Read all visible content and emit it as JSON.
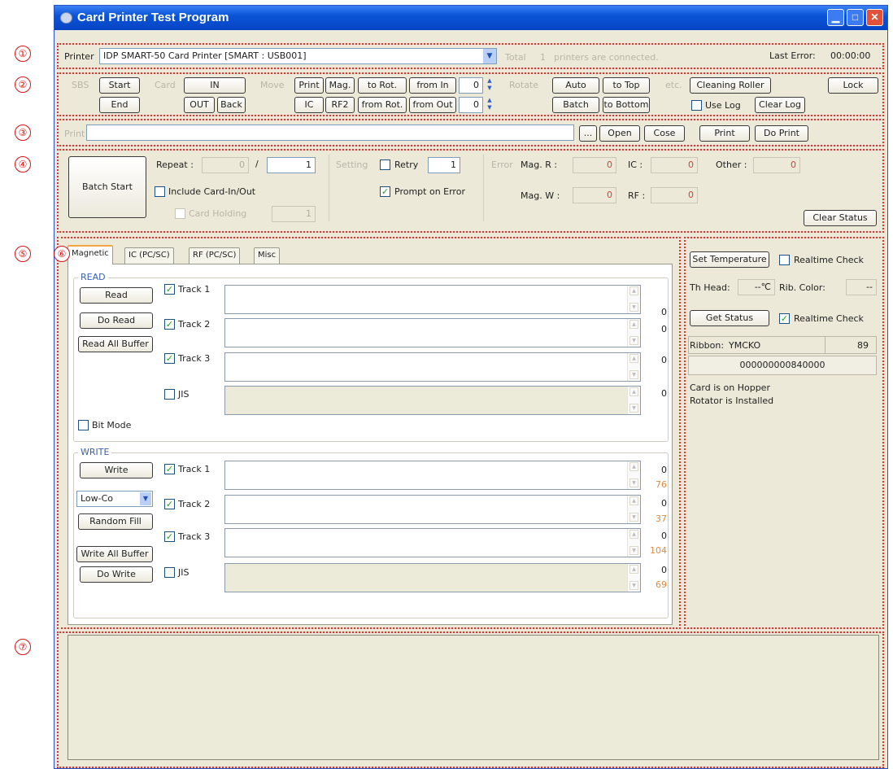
{
  "annotations": [
    "①",
    "②",
    "③",
    "④",
    "⑤",
    "⑥",
    "⑦"
  ],
  "window": {
    "title": "Card Printer Test Program"
  },
  "printer_row": {
    "label": "Printer",
    "selected": "IDP SMART-50 Card Printer  [SMART : USB001]",
    "total_label": "Total",
    "total_count": "1",
    "connected_text": "printers are connected.",
    "last_error_label": "Last Error:",
    "last_error_value": "00:00:00"
  },
  "toolbar": {
    "sbs": "SBS",
    "start": "Start",
    "end": "End",
    "card": "Card",
    "in": "IN",
    "out": "OUT",
    "back": "Back",
    "move": "Move",
    "print": "Print",
    "mag": "Mag.",
    "to_rot": "to Rot.",
    "from_in": "from In",
    "spin1": "0",
    "ic": "IC",
    "rf2": "RF2",
    "from_rot": "from Rot.",
    "from_out": "from Out",
    "spin2": "0",
    "rotate": "Rotate",
    "auto": "Auto",
    "to_top": "to Top",
    "batch": "Batch",
    "to_bottom": "to Bottom",
    "etc": "etc.",
    "cleaning_roller": "Cleaning Roller",
    "lock": "Lock",
    "use_log": "Use Log",
    "clear_log": "Clear Log"
  },
  "print_row": {
    "label": "Print",
    "value": "",
    "browse": "...",
    "open": "Open",
    "close": "Cose",
    "print": "Print",
    "do_print": "Do Print"
  },
  "batch": {
    "batch_start": "Batch Start",
    "repeat_label": "Repeat :",
    "repeat_done": "0",
    "slash": "/",
    "repeat_total": "1",
    "include_card": "Include Card-In/Out",
    "card_holding": "Card Holding",
    "card_holding_val": "1",
    "setting": "Setting",
    "retry": "Retry",
    "retry_val": "1",
    "prompt_on_error": "Prompt on Error",
    "error": "Error",
    "mag_r": "Mag. R :",
    "mag_r_val": "0",
    "ic": "IC :",
    "ic_val": "0",
    "other": "Other :",
    "other_val": "0",
    "mag_w": "Mag. W :",
    "mag_w_val": "0",
    "rf": "RF :",
    "rf_val": "0",
    "clear_status": "Clear Status"
  },
  "tabs": [
    "Magnetic",
    "IC (PC/SC)",
    "RF (PC/SC)",
    "Misc"
  ],
  "read": {
    "title": "READ",
    "read": "Read",
    "do_read": "Do Read",
    "read_all": "Read All Buffer",
    "bit_mode": "Bit Mode",
    "tracks": [
      {
        "label": "Track 1",
        "count": "0"
      },
      {
        "label": "Track 2",
        "count": "0"
      },
      {
        "label": "Track 3",
        "count": "0"
      },
      {
        "label": "JIS",
        "count": "0"
      }
    ]
  },
  "write": {
    "title": "WRITE",
    "write": "Write",
    "coercivity": "Low-Co",
    "random_fill": "Random Fill",
    "write_all": "Write All Buffer",
    "do_write": "Do Write",
    "tracks": [
      {
        "label": "Track 1",
        "count": "0",
        "max": "76"
      },
      {
        "label": "Track 2",
        "count": "0",
        "max": "37"
      },
      {
        "label": "Track 3",
        "count": "0",
        "max": "104"
      },
      {
        "label": "JIS",
        "count": "0",
        "max": "69"
      }
    ]
  },
  "status_panel": {
    "set_temperature": "Set Temperature",
    "realtime_check": "Realtime Check",
    "th_head": "Th Head:",
    "th_head_val": "--℃",
    "rib_color": "Rib. Color:",
    "rib_color_val": "--",
    "get_status": "Get Status",
    "ribbon_label": "Ribbon:",
    "ribbon_type": "YMCKO",
    "ribbon_count": "89",
    "status_code": "000000000840000",
    "msg1": "Card is on Hopper",
    "msg2": "Rotator is Installed"
  },
  "colors": {
    "annotation": "#dd1111",
    "titlebar": "#0a55d8",
    "window_bg": "#ece9d8",
    "orange_count": "#e08a40"
  }
}
